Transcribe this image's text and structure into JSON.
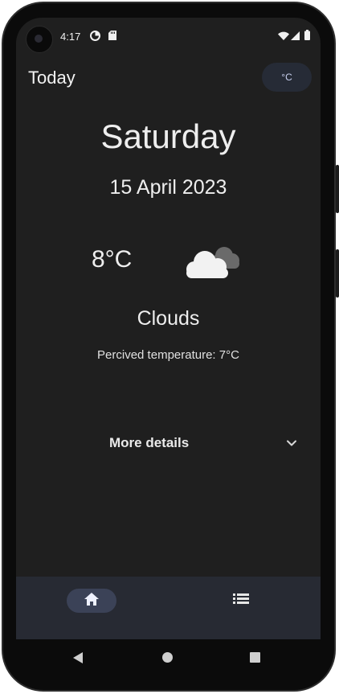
{
  "status_bar": {
    "time": "4:17",
    "icons": [
      "data-saver-icon",
      "sd-card-icon",
      "wifi-icon",
      "cellular-signal-icon",
      "battery-icon"
    ]
  },
  "app_bar": {
    "title": "Today",
    "unit_toggle_label": "°C"
  },
  "weather": {
    "day": "Saturday",
    "date": "15 April 2023",
    "temperature": "8°C",
    "condition_icon": "cloud-icon",
    "condition": "Clouds",
    "perceived": "Percived temperature: 7°C"
  },
  "details": {
    "label": "More details",
    "expanded": false
  },
  "bottom_nav": {
    "items": [
      {
        "icon": "home-icon",
        "selected": true
      },
      {
        "icon": "list-icon",
        "selected": false
      }
    ]
  },
  "system_nav": {
    "buttons": [
      "back-icon",
      "home-circle-icon",
      "recents-icon"
    ]
  },
  "colors": {
    "background": "#1f1f1f",
    "nav_bar": "#272a33",
    "selected_pill": "#3b4257",
    "toggle_bg": "#262b36",
    "text": "#eeeeee"
  }
}
